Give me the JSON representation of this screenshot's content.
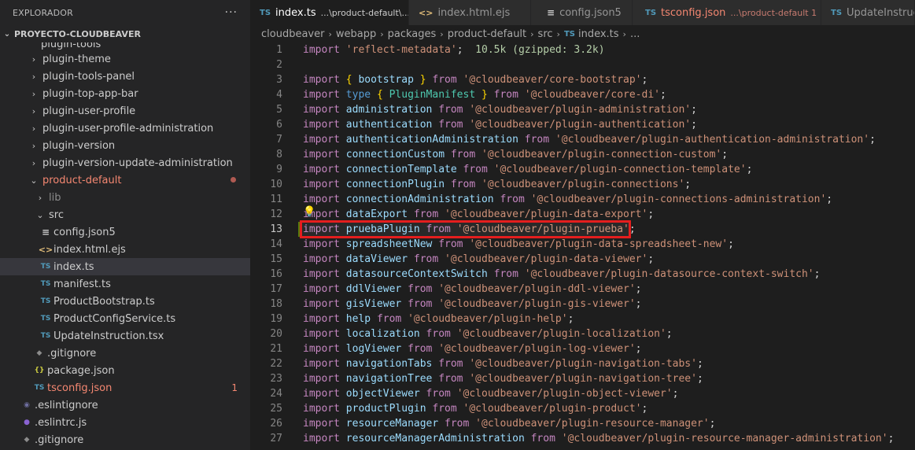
{
  "explorer": {
    "title": "EXPLORADOR",
    "more_label": "···",
    "section": "PROYECTO-CLOUDBEAVER",
    "cut_label": "plugin-tools",
    "items": [
      {
        "label": "plugin-theme",
        "twistie": "›"
      },
      {
        "label": "plugin-tools-panel",
        "twistie": "›"
      },
      {
        "label": "plugin-top-app-bar",
        "twistie": "›"
      },
      {
        "label": "plugin-user-profile",
        "twistie": "›"
      },
      {
        "label": "plugin-user-profile-administration",
        "twistie": "›"
      },
      {
        "label": "plugin-version",
        "twistie": "›"
      },
      {
        "label": "plugin-version-update-administration",
        "twistie": "›"
      },
      {
        "label": "product-default",
        "twistie": "⌄"
      },
      {
        "label": "lib",
        "twistie": "›"
      },
      {
        "label": "src",
        "twistie": "⌄"
      },
      {
        "label": "config.json5",
        "icon": "≡"
      },
      {
        "label": "index.html.ejs",
        "icon": "<>"
      },
      {
        "label": "index.ts",
        "icon": "TS"
      },
      {
        "label": "manifest.ts",
        "icon": "TS"
      },
      {
        "label": "ProductBootstrap.ts",
        "icon": "TS"
      },
      {
        "label": "ProductConfigService.ts",
        "icon": "TS"
      },
      {
        "label": "UpdateInstruction.tsx",
        "icon": "TS"
      },
      {
        "label": ".gitignore",
        "icon": "◆"
      },
      {
        "label": "package.json",
        "icon": "{}"
      },
      {
        "label": "tsconfig.json",
        "icon": "TS",
        "badge": "1"
      },
      {
        "label": ".eslintignore",
        "icon": "◉"
      },
      {
        "label": ".eslintrc.js",
        "icon": "●"
      },
      {
        "label": ".gitignore",
        "icon": "◆"
      }
    ]
  },
  "tabs": [
    {
      "icon": "TS",
      "name": "index.ts",
      "sub": "...\\product-default\\...",
      "close": "×"
    },
    {
      "icon": "<>",
      "name": "index.html.ejs"
    },
    {
      "icon": "≡",
      "name": "config.json5"
    },
    {
      "icon": "TS",
      "name": "tsconfig.json",
      "sub": "...\\product-default 1"
    },
    {
      "icon": "TS",
      "name": "UpdateInstruct"
    }
  ],
  "breadcrumb": {
    "parts": [
      "cloudbeaver",
      "webapp",
      "packages",
      "product-default",
      "src"
    ],
    "file_icon": "TS",
    "file": "index.ts",
    "tail": "...",
    "separator": "›"
  },
  "code": {
    "lines": [
      {
        "n": "1",
        "kw": "import",
        "str": "'reflect-metadata'",
        "end": ";",
        "size": "10.5k (gzipped: 3.2k)"
      },
      {
        "n": "2"
      },
      {
        "n": "3",
        "kw": "import",
        "open": "{",
        "name": "bootstrap",
        "close": "}",
        "from": "from",
        "str": "'@cloudbeaver/core-bootstrap'",
        "end": ";"
      },
      {
        "n": "4",
        "kw": "import",
        "type_kw": "type",
        "open": "{",
        "name": "PluginManifest",
        "close": "}",
        "from": "from",
        "str": "'@cloudbeaver/core-di'",
        "end": ";"
      },
      {
        "n": "5",
        "kw": "import",
        "name": "administration",
        "from": "from",
        "str": "'@cloudbeaver/plugin-administration'",
        "end": ";"
      },
      {
        "n": "6",
        "kw": "import",
        "name": "authentication",
        "from": "from",
        "str": "'@cloudbeaver/plugin-authentication'",
        "end": ";"
      },
      {
        "n": "7",
        "kw": "import",
        "name": "authenticationAdministration",
        "from": "from",
        "str": "'@cloudbeaver/plugin-authentication-administration'",
        "end": ";"
      },
      {
        "n": "8",
        "kw": "import",
        "name": "connectionCustom",
        "from": "from",
        "str": "'@cloudbeaver/plugin-connection-custom'",
        "end": ";"
      },
      {
        "n": "9",
        "kw": "import",
        "name": "connectionTemplate",
        "from": "from",
        "str": "'@cloudbeaver/plugin-connection-template'",
        "end": ";"
      },
      {
        "n": "10",
        "kw": "import",
        "name": "connectionPlugin",
        "from": "from",
        "str": "'@cloudbeaver/plugin-connections'",
        "end": ";"
      },
      {
        "n": "11",
        "kw": "import",
        "name": "connectionAdministration",
        "from": "from",
        "str": "'@cloudbeaver/plugin-connections-administration'",
        "end": ";"
      },
      {
        "n": "12",
        "kw": "import",
        "name": "dataExport",
        "from": "from",
        "str": "'@cloudbeaver/plugin-data-export'",
        "end": ";",
        "bulb": "💡"
      },
      {
        "n": "13",
        "kw": "import",
        "name": "pruebaPlugin",
        "from": "from",
        "str": "'@cloudbeaver/plugin-prueba'",
        "end": ";",
        "highlight": true
      },
      {
        "n": "14",
        "kw": "import",
        "name": "spreadsheetNew",
        "from": "from",
        "str": "'@cloudbeaver/plugin-data-spreadsheet-new'",
        "end": ";"
      },
      {
        "n": "15",
        "kw": "import",
        "name": "dataViewer",
        "from": "from",
        "str": "'@cloudbeaver/plugin-data-viewer'",
        "end": ";"
      },
      {
        "n": "16",
        "kw": "import",
        "name": "datasourceContextSwitch",
        "from": "from",
        "str": "'@cloudbeaver/plugin-datasource-context-switch'",
        "end": ";"
      },
      {
        "n": "17",
        "kw": "import",
        "name": "ddlViewer",
        "from": "from",
        "str": "'@cloudbeaver/plugin-ddl-viewer'",
        "end": ";"
      },
      {
        "n": "18",
        "kw": "import",
        "name": "gisViewer",
        "from": "from",
        "str": "'@cloudbeaver/plugin-gis-viewer'",
        "end": ";"
      },
      {
        "n": "19",
        "kw": "import",
        "name": "help",
        "from": "from",
        "str": "'@cloudbeaver/plugin-help'",
        "end": ";"
      },
      {
        "n": "20",
        "kw": "import",
        "name": "localization",
        "from": "from",
        "str": "'@cloudbeaver/plugin-localization'",
        "end": ";"
      },
      {
        "n": "21",
        "kw": "import",
        "name": "logViewer",
        "from": "from",
        "str": "'@cloudbeaver/plugin-log-viewer'",
        "end": ";"
      },
      {
        "n": "22",
        "kw": "import",
        "name": "navigationTabs",
        "from": "from",
        "str": "'@cloudbeaver/plugin-navigation-tabs'",
        "end": ";"
      },
      {
        "n": "23",
        "kw": "import",
        "name": "navigationTree",
        "from": "from",
        "str": "'@cloudbeaver/plugin-navigation-tree'",
        "end": ";"
      },
      {
        "n": "24",
        "kw": "import",
        "name": "objectViewer",
        "from": "from",
        "str": "'@cloudbeaver/plugin-object-viewer'",
        "end": ";"
      },
      {
        "n": "25",
        "kw": "import",
        "name": "productPlugin",
        "from": "from",
        "str": "'@cloudbeaver/plugin-product'",
        "end": ";"
      },
      {
        "n": "26",
        "kw": "import",
        "name": "resourceManager",
        "from": "from",
        "str": "'@cloudbeaver/plugin-resource-manager'",
        "end": ";"
      },
      {
        "n": "27",
        "kw": "import",
        "name": "resourceManagerAdministration",
        "from": "from",
        "str": "'@cloudbeaver/plugin-resource-manager-administration'",
        "end": ";"
      }
    ]
  },
  "colors": {
    "highlight_border": "#e41e1e",
    "modified_text": "#f48771",
    "added_gutter": "#587c0c"
  }
}
